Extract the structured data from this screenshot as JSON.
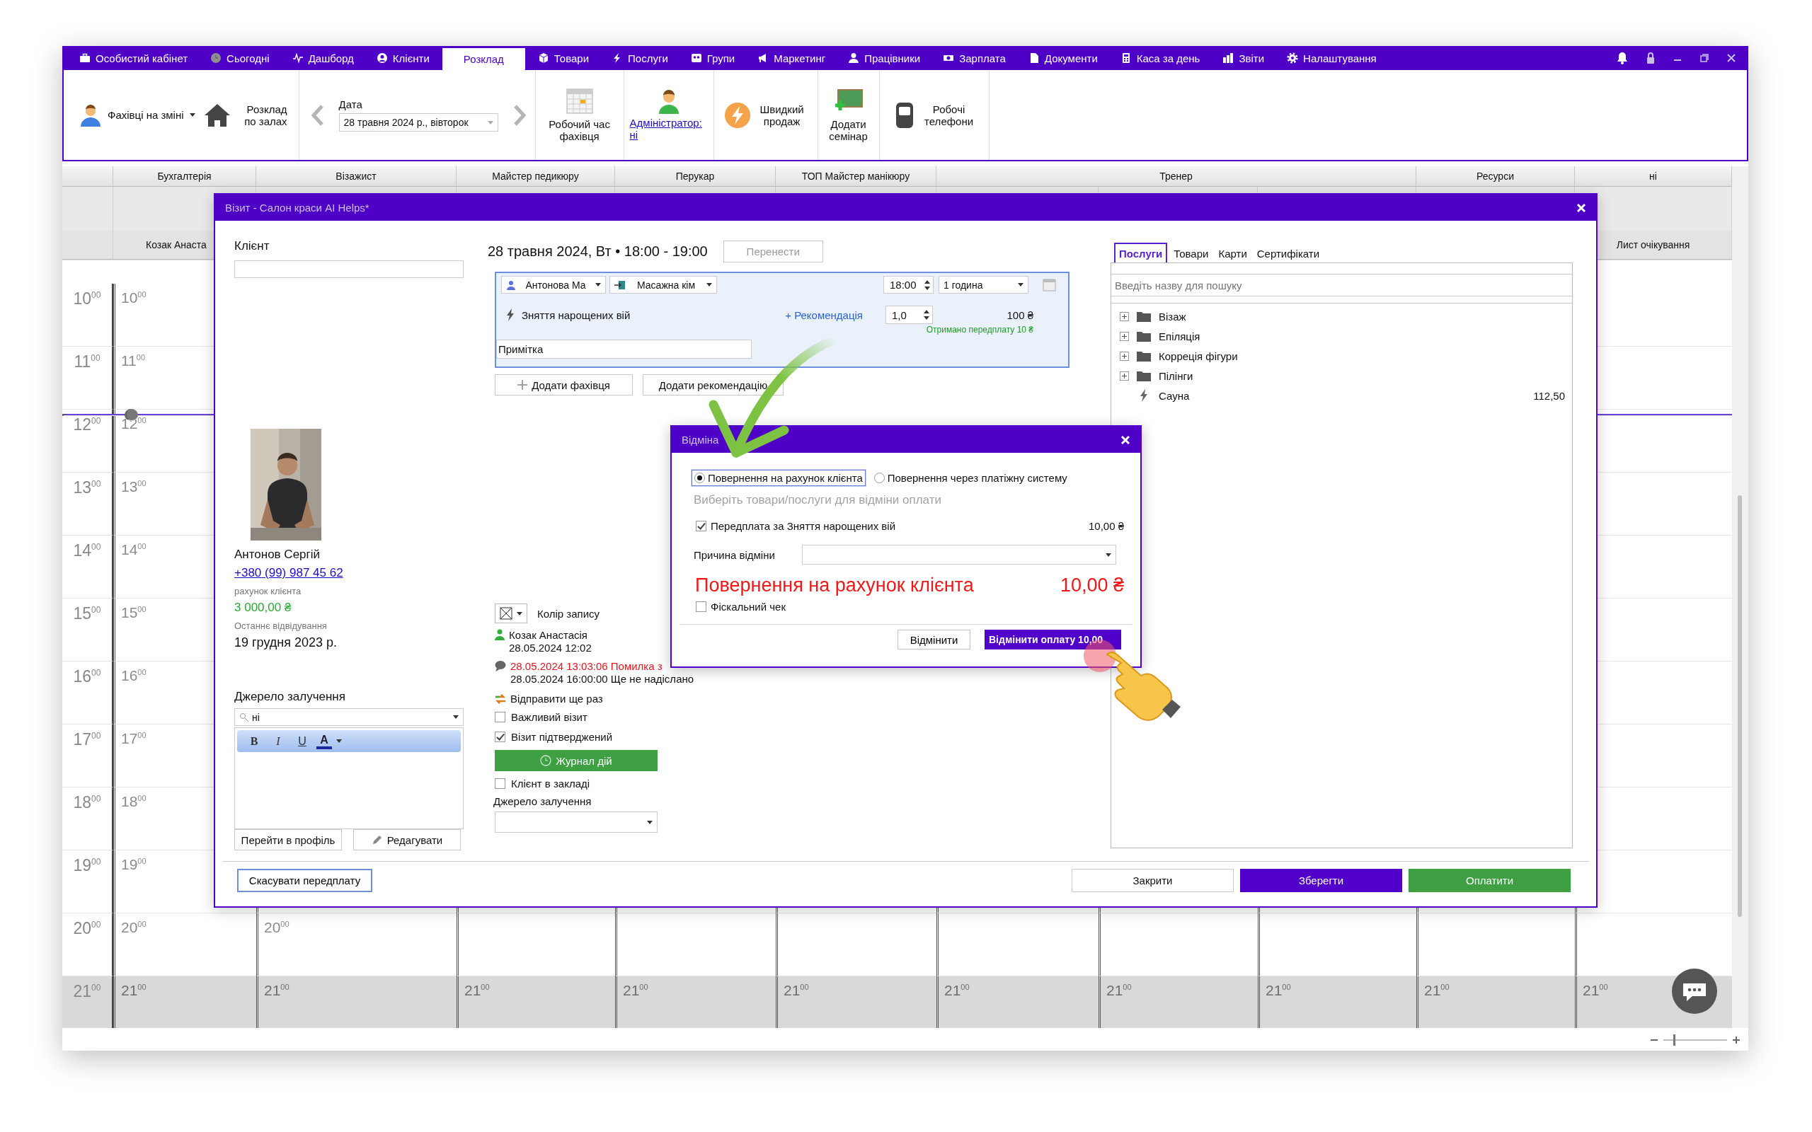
{
  "nav": {
    "items": [
      {
        "label": "Особистий кабінет",
        "selected": false
      },
      {
        "label": "Сьогодні",
        "selected": false
      },
      {
        "label": "Дашборд",
        "selected": false
      },
      {
        "label": "Клієнти",
        "selected": false
      },
      {
        "label": "Розклад",
        "selected": true
      },
      {
        "label": "Товари",
        "selected": false
      },
      {
        "label": "Послуги",
        "selected": false
      },
      {
        "label": "Групи",
        "selected": false
      },
      {
        "label": "Маркетинг",
        "selected": false
      },
      {
        "label": "Працівники",
        "selected": false
      },
      {
        "label": "Зарплата",
        "selected": false
      },
      {
        "label": "Документи",
        "selected": false
      },
      {
        "label": "Каса за день",
        "selected": false
      },
      {
        "label": "Звіти",
        "selected": false
      },
      {
        "label": "Налаштування",
        "selected": false
      }
    ]
  },
  "toolbar": {
    "staff_on_shift": "Фахівці на зміні",
    "halls_schedule": "Розклад по залах",
    "date_label": "Дата",
    "date_value": "28 травня 2024 р., вівторок",
    "work_time": "Робочий час фахівця",
    "administrator": "Адміністратор: ні",
    "quick_sale": "Швидкий продаж",
    "add_seminar": "Додати семінар",
    "work_phones": "Робочі телефони"
  },
  "zoom": {
    "level": 0.15
  },
  "calendar": {
    "groups": [
      {
        "label": "Бухгалтерія",
        "staff": "Козак Анаста"
      },
      {
        "label": "Візажист"
      },
      {
        "label": "Майстер педикюру"
      },
      {
        "label": "Перукар"
      },
      {
        "label": "ТОП Майстер манікюру"
      },
      {
        "label": "Тренер"
      },
      {
        "label": "Ресурси"
      },
      {
        "label": "ні",
        "staff": "Лист очікування"
      }
    ],
    "rows": [
      {
        "label": "10$^{00}$",
        "now": false,
        "off_hours": false,
        "cells": [
          "10$^{00}$"
        ]
      },
      {
        "label": "11$^{00}$",
        "now": false,
        "off_hours": false,
        "cells": [
          "11$^{00}$"
        ]
      },
      {
        "label": "12$^{00}$",
        "now": true,
        "off_hours": false,
        "cells": [
          "12$^{00}$"
        ]
      },
      {
        "label": "13$^{00}$",
        "now": false,
        "off_hours": false,
        "cells": [
          "13$^{00}$"
        ]
      },
      {
        "label": "14$^{00}$",
        "now": false,
        "off_hours": false,
        "cells": [
          "14$^{00}$"
        ]
      },
      {
        "label": "15$^{00}$",
        "now": false,
        "off_hours": false,
        "cells": [
          "15$^{00}$"
        ]
      },
      {
        "label": "16$^{00}$",
        "now": false,
        "off_hours": false,
        "cells": [
          "16$^{00}$"
        ]
      },
      {
        "label": "17$^{00}$",
        "now": false,
        "off_hours": false,
        "cells": [
          "17$^{00}$"
        ]
      },
      {
        "label": "18$^{00}$",
        "now": false,
        "off_hours": false,
        "cells": [
          "18$^{00}$"
        ]
      },
      {
        "label": "19$^{00}$",
        "now": false,
        "off_hours": false,
        "cells": [
          "19$^{00}$"
        ]
      },
      {
        "label": "20$^{00}$",
        "now": false,
        "off_hours": false,
        "cells": [
          "20$^{00}$",
          "20$^{00}$"
        ]
      },
      {
        "label": "21$^{00}$",
        "now": false,
        "off_hours": true,
        "cells": [
          "21$^{00}$",
          "21$^{00}$",
          "21$^{00}$",
          "21$^{00}$",
          "21$^{00}$",
          "21$^{00}$",
          "21$^{00}$",
          "21$^{00}$",
          "21$^{00}$",
          "21$^{00}$"
        ]
      }
    ]
  },
  "visit_dialog": {
    "title": "Візит - Салон краси AI Helps*",
    "client": {
      "label": "Клієнт",
      "photo": {
        "kind": "picture"
      },
      "name": "Антонов Сергій",
      "phone": "+380 (99) 987 45 62",
      "account_label": "рахунок клієнта",
      "account_balance": "3 000,00 ₴",
      "last_visit_label": "Останнє відвідування",
      "last_visit": "19 грудня 2023 р.",
      "source_label": "Джерело залучення",
      "source_value": "ні",
      "editor_buttons": [
        "B",
        "I",
        "U",
        "A"
      ],
      "profile_button": "Перейти в профіль",
      "edit_button": "Редагувати"
    },
    "appointment": {
      "datetime": "28 травня 2024, Вт • 18:00 - 19:00",
      "move_button": "Перенести",
      "specialist": "Антонова Ма",
      "room": "Масажна кім",
      "time": "18:00",
      "duration": "1 година",
      "service": "Зняття нарощених вій",
      "recommend_link": "+ Рекомендація",
      "quantity": "1,0",
      "price": "100 ₴",
      "prepayment_note": "Отримано передплату 10 ₴",
      "note_value": "Примітка",
      "add_specialist_button": "Додати фахівця",
      "add_recommendation_button": "Додати рекомендацію"
    },
    "record": {
      "color_label": "Колір запису",
      "history": [
        {
          "kind": "person",
          "lines": [
            {
              "text": "Козак Анастасія",
              "error": false
            },
            {
              "text": "28.05.2024 12:02",
              "error": false
            }
          ]
        },
        {
          "kind": "message",
          "lines": [
            {
              "text": "28.05.2024 13:03:06 Помилка з",
              "error": true
            },
            {
              "text": "28.05.2024 16:00:00 Ще не надіслано",
              "error": false
            }
          ]
        }
      ],
      "resend": "Відправити ще раз",
      "flags": [
        {
          "label": "Важливий візит",
          "checked": false
        },
        {
          "label": "Візит підтверджений",
          "checked": true
        }
      ],
      "log_button": "Журнал дій",
      "in_venue": {
        "label": "Клієнт в закладі",
        "checked": false
      },
      "source_label": "Джерело залучення"
    },
    "catalog": {
      "tabs": [
        {
          "label": "Послуги",
          "selected": true
        },
        {
          "label": "Товари",
          "selected": false
        },
        {
          "label": "Карти",
          "selected": false
        },
        {
          "label": "Сертифікати",
          "selected": false
        }
      ],
      "search": {
        "placeholder": "Введіть назву для пошуку"
      },
      "items": [
        {
          "kind": "folder",
          "label": "Візаж",
          "expanded": false
        },
        {
          "kind": "folder",
          "label": "Епіляція",
          "expanded": false
        },
        {
          "kind": "folder",
          "label": "Корреція фігури",
          "expanded": false
        },
        {
          "kind": "folder",
          "label": "Пілінги",
          "expanded": false
        },
        {
          "kind": "service",
          "label": "Сауна",
          "price": "112,50"
        }
      ]
    },
    "footer": {
      "cancel_prepayment": "Скасувати передплату",
      "close": "Закрити",
      "save": "Зберегти",
      "pay": "Оплатити"
    }
  },
  "refund_dialog": {
    "title": "Відміна",
    "options": [
      {
        "label": "Повернення на рахунок клієнта",
        "selected": true
      },
      {
        "label": "Повернення через платіжну систему",
        "selected": false
      }
    ],
    "hint": "Виберіть товари/послуги для відміни оплати",
    "lines": [
      {
        "label": "Передплата за Зняття нарощених вій",
        "checked": true,
        "amount": "10,00 ₴"
      }
    ],
    "reason_label": "Причина відміни",
    "refund_label": "Повернення на рахунок клієнта",
    "refund_amount": "10,00 ₴",
    "fiscal": {
      "label": "Фіскальний чек",
      "checked": false
    },
    "cancel_button": "Відмінити",
    "confirm_button": "Відмінити оплату 10,00"
  }
}
